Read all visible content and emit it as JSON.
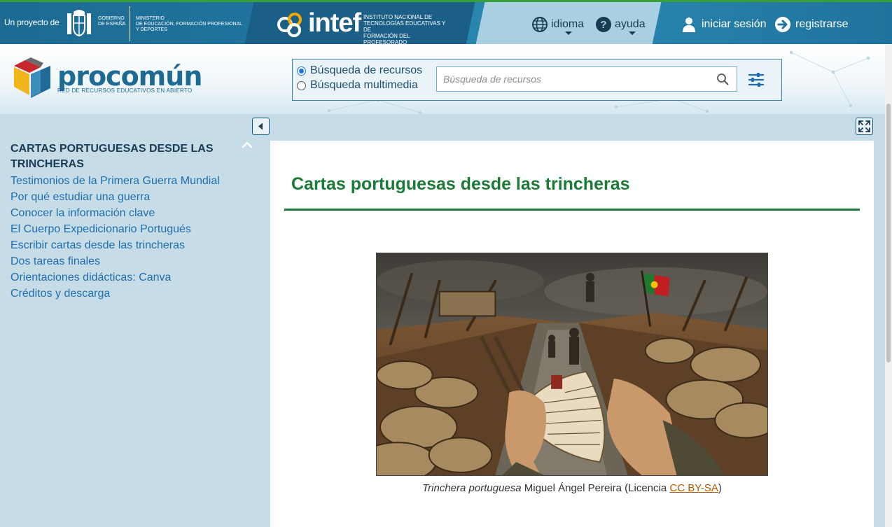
{
  "topbar": {
    "proyecto": "Un proyecto de",
    "gobierno": "GOBIERNO\nDE ESPAÑA",
    "ministerio": "MINISTERIO\nDE EDUCACIÓN, FORMACIÓN PROFESIONAL\nY DEPORTES",
    "intef_word": "intef",
    "intef_desc": "INSTITUTO NACIONAL DE\nTECNOLOGÍAS EDUCATIVAS Y DE\nFORMACIÓN DEL PROFESORADO",
    "idioma_label": "idioma",
    "ayuda_label": "ayuda",
    "login_label": "iniciar sesión",
    "register_label": "registrarse"
  },
  "header": {
    "logo_name": "procomún",
    "logo_sub": "RED DE RECURSOS EDUCATIVOS EN ABIERTO",
    "radio_recursos": "Búsqueda de recursos",
    "radio_multimedia": "Búsqueda multimedia",
    "search_placeholder": "Búsqueda de recursos",
    "selected_mode": "recursos"
  },
  "sidebar": {
    "title": "CARTAS PORTUGUESAS DESDE LAS TRINCHERAS",
    "items": [
      "Testimonios de la Primera Guerra Mundial",
      "Por qué estudiar una guerra",
      "Conocer la información clave",
      "El Cuerpo Expedicionario Portugués",
      "Escribir cartas desde las trincheras",
      "Dos tareas finales",
      "Orientaciones didácticas: Canva",
      "Créditos y descarga"
    ]
  },
  "main": {
    "title": "Cartas portuguesas desde las trincheras",
    "caption_title": "Trinchera portuguesa",
    "caption_author": " Miguel Ángel Pereira  (Licencia ",
    "caption_license": "CC BY-SA",
    "caption_close": ")"
  },
  "colors": {
    "topbar": "#1d6a92",
    "accent_green": "#1b7a36",
    "link_blue": "#1f6db0",
    "sidebar_bg": "#c6dde7",
    "license_link": "#b35a00"
  }
}
